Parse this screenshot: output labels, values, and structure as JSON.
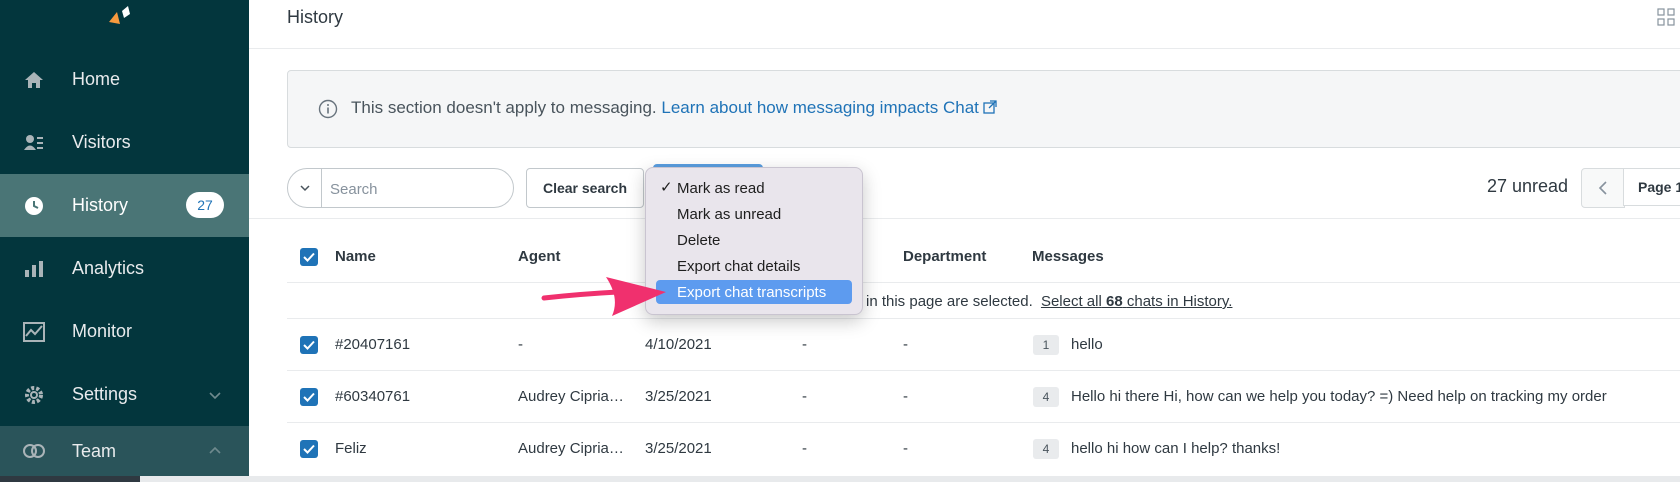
{
  "sidebar": {
    "items": [
      {
        "label": "Home",
        "icon": "home-icon"
      },
      {
        "label": "Visitors",
        "icon": "visitors-icon"
      },
      {
        "label": "History",
        "icon": "clock-icon",
        "badge": "27",
        "active": true
      },
      {
        "label": "Analytics",
        "icon": "analytics-icon"
      },
      {
        "label": "Monitor",
        "icon": "monitor-icon"
      },
      {
        "label": "Settings",
        "icon": "gear-icon"
      },
      {
        "label": "Team",
        "icon": "team-icon"
      }
    ]
  },
  "header": {
    "title": "History"
  },
  "notice": {
    "text": "This section doesn't apply to messaging.",
    "link": "Learn about how messaging impacts Chat"
  },
  "toolbar": {
    "search_placeholder": "Search",
    "clear_label": "Clear search",
    "unread": "27 unread",
    "page_label": "Page 1"
  },
  "dropdown": {
    "items": [
      "Mark as read",
      "Mark as unread",
      "Delete",
      "Export chat details",
      "Export chat transcripts"
    ],
    "checked_index": 0,
    "highlighted_index": 4
  },
  "table": {
    "headers": [
      "Name",
      "Agent",
      "Department",
      "Messages"
    ],
    "banner_text": "in this page are selected.",
    "banner_link_pre": "Select all",
    "banner_link_count": "68",
    "banner_link_post": "chats in History.",
    "rows": [
      {
        "name": "#20407161",
        "agent": "-",
        "date": "4/10/2021",
        "col4": "-",
        "department": "-",
        "count": "1",
        "message": "hello"
      },
      {
        "name": "#60340761",
        "agent": "Audrey Cipria…",
        "date": "3/25/2021",
        "col4": "-",
        "department": "-",
        "count": "4",
        "message": "Hello hi there Hi, how can we help you today? =) Need help on tracking my order"
      },
      {
        "name": "Feliz",
        "agent": "Audrey Cipria…",
        "date": "3/25/2021",
        "col4": "-",
        "department": "-",
        "count": "4",
        "message": "hello hi how can I help? thanks!"
      }
    ]
  },
  "colors": {
    "sidebar_bg": "#03363d",
    "sidebar_active": "#4a7576",
    "accent_blue": "#1f73b7",
    "menu_highlight": "#5d9bef",
    "arrow_pink": "#f0306e",
    "logo_orange": "#f79a3e"
  }
}
